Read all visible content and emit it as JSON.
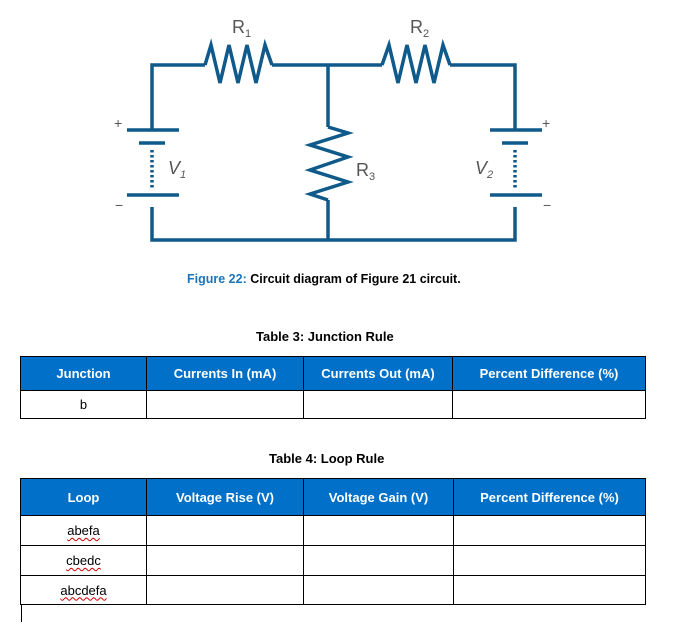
{
  "figure": {
    "labels": {
      "r1": "R",
      "r1_sub": "1",
      "r2": "R",
      "r2_sub": "2",
      "r3": "R",
      "r3_sub": "3",
      "v1": "V",
      "v1_sub": "1",
      "v2": "V",
      "v2_sub": "2",
      "plus": "+",
      "minus": "−"
    },
    "wire_color": "#0f5a8a",
    "caption_prefix": "Figure 22:",
    "caption_text": " Circuit diagram of Figure 21 circuit.",
    "caption_prefix_color": "#1a75bc"
  },
  "table3": {
    "title": "Table 3: Junction Rule",
    "headers": [
      "Junction",
      "Currents In (mA)",
      "Currents Out (mA)",
      "Percent Difference (%)"
    ],
    "rows": [
      [
        "b",
        "",
        "",
        ""
      ]
    ]
  },
  "table4": {
    "title": "Table 4: Loop Rule",
    "headers": [
      "Loop",
      "Voltage Rise (V)",
      "Voltage Gain (V)",
      "Percent Difference (%)"
    ],
    "rows": [
      [
        "abefa",
        "",
        "",
        ""
      ],
      [
        "cbedc",
        "",
        "",
        ""
      ],
      [
        "abcdefa",
        "",
        "",
        ""
      ]
    ]
  },
  "colors": {
    "header_bg": "#0070c8",
    "header_text": "#ffffff"
  }
}
